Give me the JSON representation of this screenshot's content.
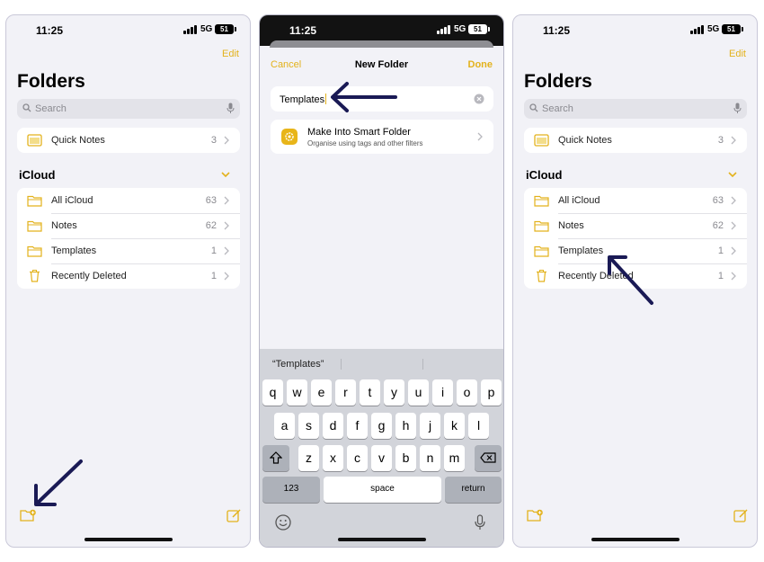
{
  "colors": {
    "accent": "#e3b21c",
    "arrow": "#1a1a55",
    "background": "#f2f2f7"
  },
  "status": {
    "time": "11:25",
    "network": "5G",
    "battery": "51"
  },
  "folders_screen": {
    "edit_label": "Edit",
    "title": "Folders",
    "search_placeholder": "Search",
    "quick_notes": {
      "label": "Quick Notes",
      "count": "3",
      "icon": "quick-notes-icon"
    },
    "section_title": "iCloud",
    "items": [
      {
        "label": "All iCloud",
        "count": "63",
        "icon": "folder-icon"
      },
      {
        "label": "Notes",
        "count": "62",
        "icon": "folder-icon"
      },
      {
        "label": "Templates",
        "count": "1",
        "icon": "folder-icon"
      },
      {
        "label": "Recently Deleted",
        "count": "1",
        "icon": "trash-icon"
      }
    ]
  },
  "new_folder_screen": {
    "cancel_label": "Cancel",
    "title": "New Folder",
    "done_label": "Done",
    "name_value": "Templates",
    "smart_folder_title": "Make Into Smart Folder",
    "smart_folder_subtitle": "Organise using tags and other filters",
    "suggestion": "“Templates”"
  },
  "keyboard": {
    "row1": [
      "q",
      "w",
      "e",
      "r",
      "t",
      "y",
      "u",
      "i",
      "o",
      "p"
    ],
    "row2": [
      "a",
      "s",
      "d",
      "f",
      "g",
      "h",
      "j",
      "k",
      "l"
    ],
    "row3": [
      "z",
      "x",
      "c",
      "v",
      "b",
      "n",
      "m"
    ],
    "numbers_label": "123",
    "space_label": "space",
    "return_label": "return"
  }
}
